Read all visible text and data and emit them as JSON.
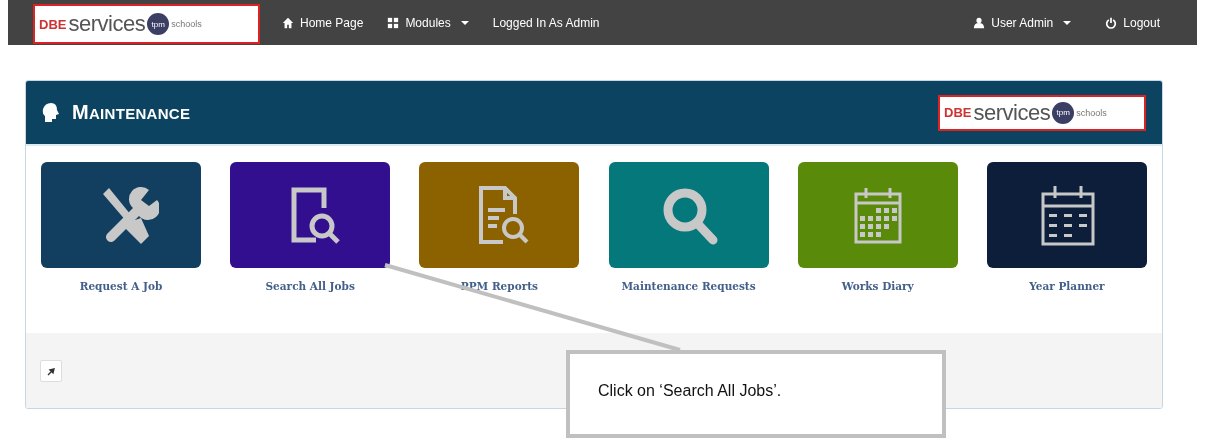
{
  "navbar": {
    "logo": {
      "brand": "DBE",
      "word": "services",
      "badge": "tpm",
      "suffix": "schools"
    },
    "items": [
      {
        "kind": "home",
        "label": "Home Page"
      },
      {
        "kind": "grid",
        "label": "Modules",
        "dropdown": true
      },
      {
        "kind": "text",
        "label": "Logged In As Admin"
      }
    ],
    "right_items": [
      {
        "kind": "user",
        "label": "User Admin",
        "dropdown": true
      },
      {
        "kind": "power",
        "label": "Logout"
      }
    ]
  },
  "panel": {
    "title": "MAINTENANCE",
    "logo": {
      "brand": "DBE",
      "word": "services",
      "badge": "tpm",
      "suffix": "schools"
    },
    "tiles": [
      {
        "label": "Request A Job",
        "kind": "tools",
        "color": "#123f60"
      },
      {
        "label": "Search All Jobs",
        "kind": "docsearch",
        "color": "#320f8f"
      },
      {
        "label": "PPM Reports",
        "kind": "report",
        "color": "#8c6200"
      },
      {
        "label": "Maintenance Requests",
        "kind": "magnifier",
        "color": "#05787b"
      },
      {
        "label": "Works Diary",
        "kind": "diary",
        "color": "#598a0a"
      },
      {
        "label": "Year Planner",
        "kind": "planner",
        "color": "#0c1e3a"
      }
    ]
  },
  "callout": {
    "text": "Click on ‘Search All Jobs’."
  }
}
